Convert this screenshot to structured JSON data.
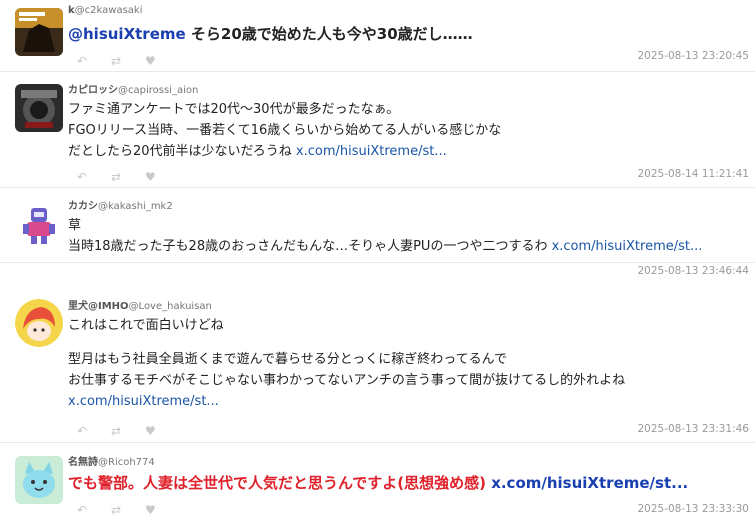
{
  "posts": [
    {
      "display_name": "k",
      "handle": "@c2kawasaki",
      "lines": [],
      "big": {
        "mention": "@hisuiXtreme",
        "text": " そら20歳で始めた人も今や30歳だし……"
      },
      "timestamp": "2025-08-13 23:20:45",
      "avatar_icon": "horse-book-cover-avatar"
    },
    {
      "display_name": "カピロッシ",
      "handle": "@capirossi_aion",
      "lines": [
        "ファミ通アンケートでは20代〜30代が最多だったなぁ。",
        "FGOリリース当時、一番若くて16歳くらいから始めてる人がいる感じかな",
        "だとしたら20代前半は少ないだろうね "
      ],
      "link": "x.com/hisuiXtreme/st...",
      "timestamp": "2025-08-14 11:21:41",
      "avatar_icon": "car-cockpit-avatar"
    },
    {
      "display_name": "カカシ",
      "handle": "@kakashi_mk2",
      "lines": [
        "草",
        "当時18歳だった子も28歳のおっさんだもんな…そりゃ人妻PUの一つや二つするわ "
      ],
      "link": "x.com/hisuiXtreme/st...",
      "timestamp": "2025-08-13 23:46:44",
      "avatar_icon": "robot-figure-avatar"
    },
    {
      "display_name": "里犬@IMHO",
      "handle": "@Love_hakuisan",
      "lines": [
        "これはこれで面白いけどね",
        "",
        "型月はもう社員全員逝くまで遊んで暮らせる分とっくに稼ぎ終わってるんで",
        "お仕事するモチベがそこじゃない事わかってないアンチの言う事って間が抜けてるし的外れよね"
      ],
      "link": "x.com/hisuiXtreme/st...",
      "timestamp": "2025-08-13 23:31:46",
      "avatar_icon": "anime-girl-avatar"
    },
    {
      "display_name": "名無詩",
      "handle": "@Ricoh774",
      "lines": [],
      "big": {
        "red": "でも警部。人妻は全世代で人気だと思うんですよ(思想強め感) ",
        "link": "x.com/hisuiXtreme/st..."
      },
      "timestamp": "2025-08-13 23:33:30",
      "avatar_icon": "cat-mascot-avatar"
    }
  ],
  "actions": {
    "reply_icon": "reply-icon",
    "retweet_icon": "retweet-icon",
    "like_icon": "heart-icon"
  },
  "colors": {
    "link": "#1a55a6",
    "mention": "#1a3fb0",
    "red_text": "#e0202a",
    "timestamp": "#9a9a9a"
  }
}
